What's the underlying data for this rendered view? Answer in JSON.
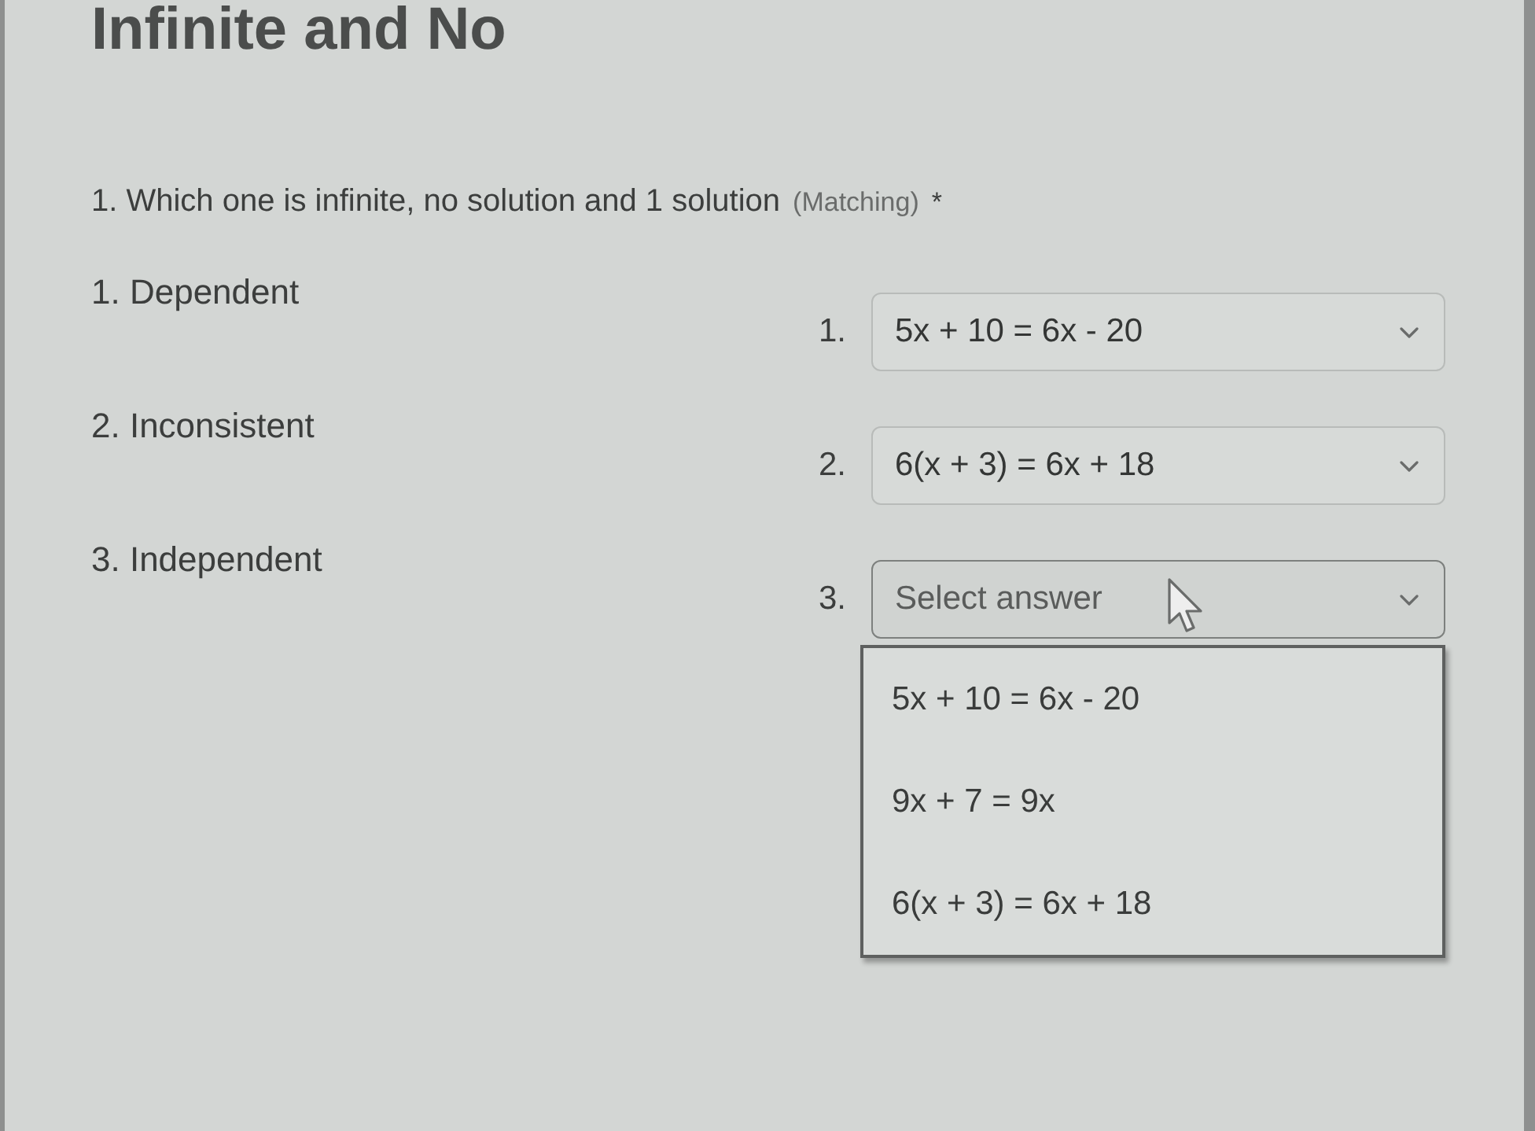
{
  "quiz_title": "Infinite and No",
  "question": {
    "text": "1. Which one is infinite, no solution and 1 solution",
    "type_label": "(Matching)",
    "required_mark": "*"
  },
  "prompts": [
    {
      "label": "1. Dependent"
    },
    {
      "label": "2. Inconsistent"
    },
    {
      "label": "3. Independent"
    }
  ],
  "answers": [
    {
      "number": "1.",
      "value": "5x + 10 = 6x - 20",
      "expanded": false
    },
    {
      "number": "2.",
      "value": "6(x + 3) = 6x + 18",
      "expanded": false
    },
    {
      "number": "3.",
      "placeholder": "Select answer",
      "expanded": true,
      "options": [
        {
          "label": "5x + 10 = 6x - 20",
          "selected": false
        },
        {
          "label": "9x + 7 = 9x",
          "selected": false
        },
        {
          "label": "6(x + 3) = 6x + 18",
          "selected": false
        }
      ]
    }
  ]
}
